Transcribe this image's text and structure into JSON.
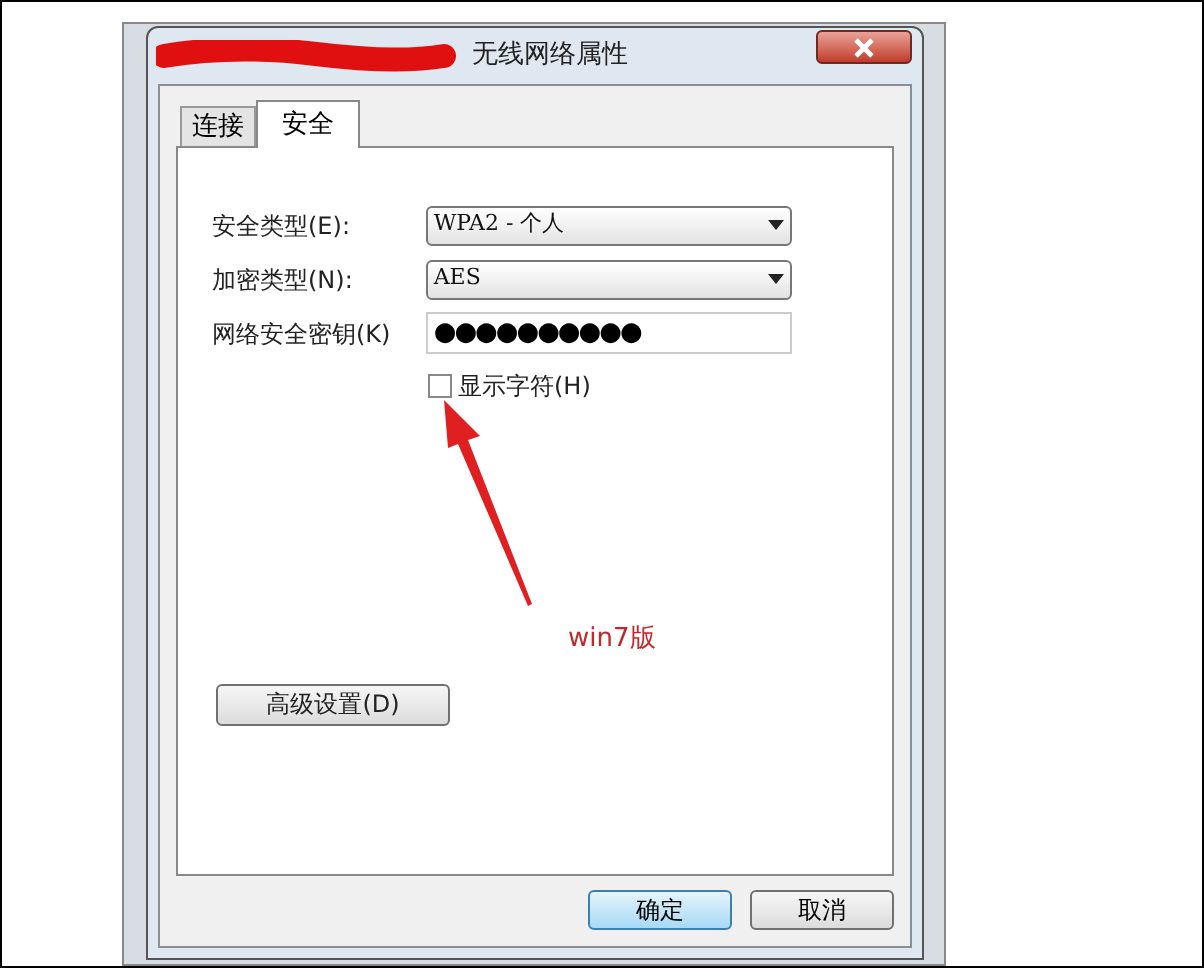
{
  "window": {
    "title": "无线网络属性"
  },
  "tabs": [
    {
      "label": "连接",
      "selected": false
    },
    {
      "label": "安全",
      "selected": true
    }
  ],
  "fields": [
    {
      "kind": "dropdown",
      "label": "安全类型(E):",
      "value": "WPA2 - 个人"
    },
    {
      "kind": "dropdown",
      "label": "加密类型(N):",
      "value": "AES"
    },
    {
      "kind": "password",
      "label": "网络安全密钥(K)",
      "value": "●●●●●●●●●●"
    }
  ],
  "show_characters": {
    "label": "显示字符(H)",
    "checked": false
  },
  "annotation": {
    "text": "win7版"
  },
  "advanced_button": "高级设置(D)",
  "buttons": [
    {
      "label": "确定",
      "default": true
    },
    {
      "label": "取消",
      "default": false
    }
  ]
}
